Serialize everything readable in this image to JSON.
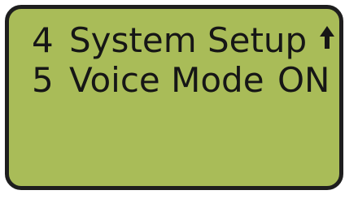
{
  "screen": {
    "background_color": "#a9bc58",
    "text_color": "#161616",
    "border_color": "#1e1e1e"
  },
  "menu": {
    "items": [
      {
        "number": "4",
        "label": "System Setup"
      },
      {
        "number": "5",
        "label": "Voice Mode",
        "value": "ON"
      }
    ],
    "scroll_indicator_icon": "up-arrow-icon"
  }
}
